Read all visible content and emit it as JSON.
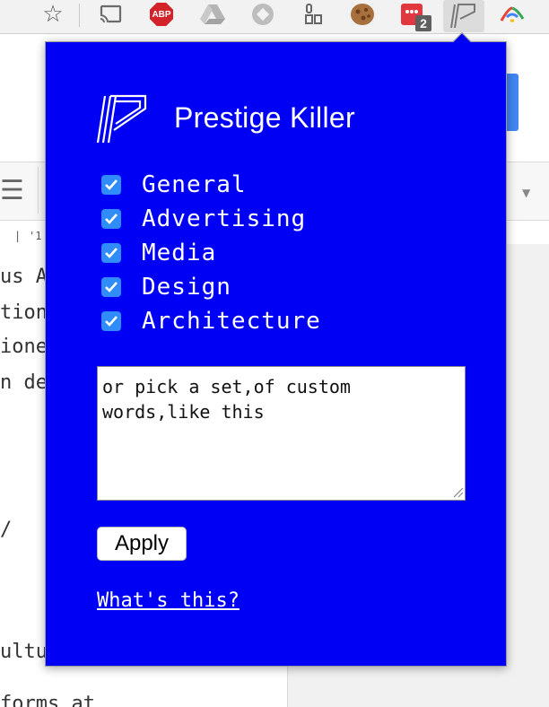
{
  "toolbar": {
    "icons": [
      "star-icon",
      "cast-icon",
      "adblock-plus-icon",
      "google-drive-icon",
      "extension-icon",
      "people-icon",
      "cookie-icon",
      "todoist-icon",
      "prestige-killer-extension-icon",
      "pinwheel-icon"
    ],
    "abp_label": "ABP",
    "badge_count": "2"
  },
  "background_page": {
    "ruler": [
      "|",
      "'1"
    ],
    "lines": [
      "us A",
      "tion",
      "ione",
      "n de",
      "/",
      "ultu",
      "forms at"
    ]
  },
  "popup": {
    "title": "Prestige Killer",
    "categories": [
      {
        "label": "General",
        "checked": true
      },
      {
        "label": "Advertising",
        "checked": true
      },
      {
        "label": "Media",
        "checked": true
      },
      {
        "label": "Design",
        "checked": true
      },
      {
        "label": "Architecture",
        "checked": true
      }
    ],
    "custom_words": "or pick a set,of custom\nwords,like this",
    "apply_label": "Apply",
    "help_link": "What's this?"
  },
  "colors": {
    "popup_bg": "#0000f5",
    "checkbox": "#2f8cf9",
    "text": "#ffffff"
  }
}
